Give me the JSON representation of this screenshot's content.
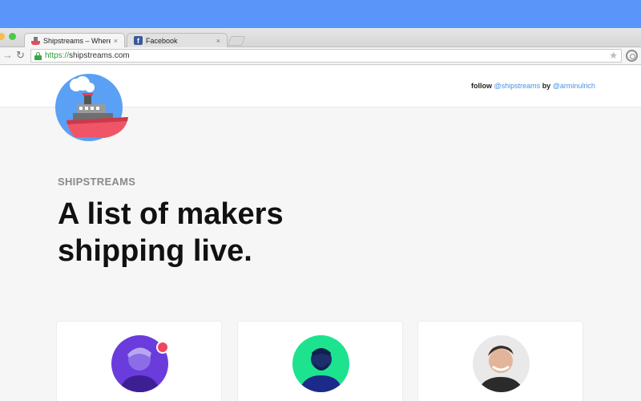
{
  "browser": {
    "tabs": [
      {
        "label": "Shipstreams – Where Mak",
        "active": true,
        "icon": "ship-favicon-icon"
      },
      {
        "label": "Facebook",
        "active": false,
        "icon": "facebook-favicon-icon"
      }
    ],
    "tab_close_glyph": "×",
    "url_scheme": "https://",
    "url_host": "shipstreams.com"
  },
  "header": {
    "follow_word": "follow",
    "follow_handle": "@shipstreams",
    "by_word": "by",
    "author_handle": "@arminulrich"
  },
  "hero": {
    "eyebrow": "SHIPSTREAMS",
    "headline": "A list of makers shipping live."
  },
  "makers": [
    {
      "avatar_color": "#6a3cdc",
      "live": true
    },
    {
      "avatar_color": "#1de38f",
      "live": false
    },
    {
      "avatar_color": "#e9e9e9",
      "live": false
    }
  ],
  "colors": {
    "top_band": "#5a95f9",
    "link": "#4a90e2",
    "live_dot": "#f0465b",
    "logo_circle": "#5aa0f5",
    "ship_hull": "#f05467"
  }
}
